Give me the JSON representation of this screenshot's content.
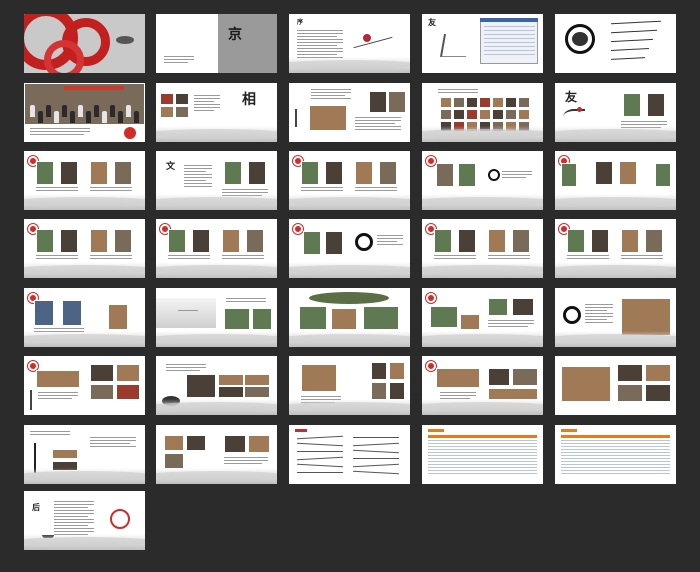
{
  "title": "",
  "colors": {
    "background": "#2b2b2b",
    "page": "#ffffff",
    "accent_red": "#d32a2a",
    "accent_orange": "#e8791f",
    "ink": "#111111"
  },
  "grid": {
    "columns": 5,
    "rows": 8,
    "total_pages": 36
  },
  "pages": [
    {
      "kind": "cover-red",
      "label": "cover"
    },
    {
      "kind": "cover-grey",
      "label": "title-page"
    },
    {
      "kind": "text-flower",
      "label": "preface"
    },
    {
      "kind": "text-screenshot",
      "label": "web-page"
    },
    {
      "kind": "enso-text",
      "label": "calligraphy"
    },
    {
      "kind": "group-photo",
      "label": "group-photo"
    },
    {
      "kind": "calligraphy-photos",
      "label": "chapter"
    },
    {
      "kind": "photo-text",
      "label": "memories"
    },
    {
      "kind": "photo-grid",
      "label": "portrait-wall"
    },
    {
      "kind": "calligraphy-portraits",
      "label": "profile"
    },
    {
      "kind": "portraits4",
      "label": "portraits"
    },
    {
      "kind": "calligraphy-portraits2",
      "label": "friends"
    },
    {
      "kind": "portraits4",
      "label": "portraits"
    },
    {
      "kind": "portraits-text",
      "label": "portraits"
    },
    {
      "kind": "portraits4-green",
      "label": "portraits"
    },
    {
      "kind": "portraits4",
      "label": "portraits"
    },
    {
      "kind": "portraits4",
      "label": "portraits"
    },
    {
      "kind": "portraits-enso",
      "label": "portraits"
    },
    {
      "kind": "portraits4",
      "label": "portraits"
    },
    {
      "kind": "portraits4",
      "label": "portraits"
    },
    {
      "kind": "portraits3",
      "label": "portraits"
    },
    {
      "kind": "landscape-photos",
      "label": "travel"
    },
    {
      "kind": "outdoor-photos",
      "label": "outing"
    },
    {
      "kind": "outdoor-photos2",
      "label": "outing"
    },
    {
      "kind": "enso-dinner",
      "label": "dinner"
    },
    {
      "kind": "ink-photos",
      "label": "gathering"
    },
    {
      "kind": "banquet",
      "label": "banquet"
    },
    {
      "kind": "banquet2",
      "label": "banquet"
    },
    {
      "kind": "banquet3",
      "label": "banquet"
    },
    {
      "kind": "banquet4",
      "label": "banquet"
    },
    {
      "kind": "ink-photos2",
      "label": "gathering"
    },
    {
      "kind": "ink-photos3",
      "label": "gathering"
    },
    {
      "kind": "handwriting",
      "label": "messages"
    },
    {
      "kind": "table",
      "label": "contact-list"
    },
    {
      "kind": "table",
      "label": "contact-list"
    },
    {
      "kind": "back-cover",
      "label": "afterword"
    }
  ]
}
